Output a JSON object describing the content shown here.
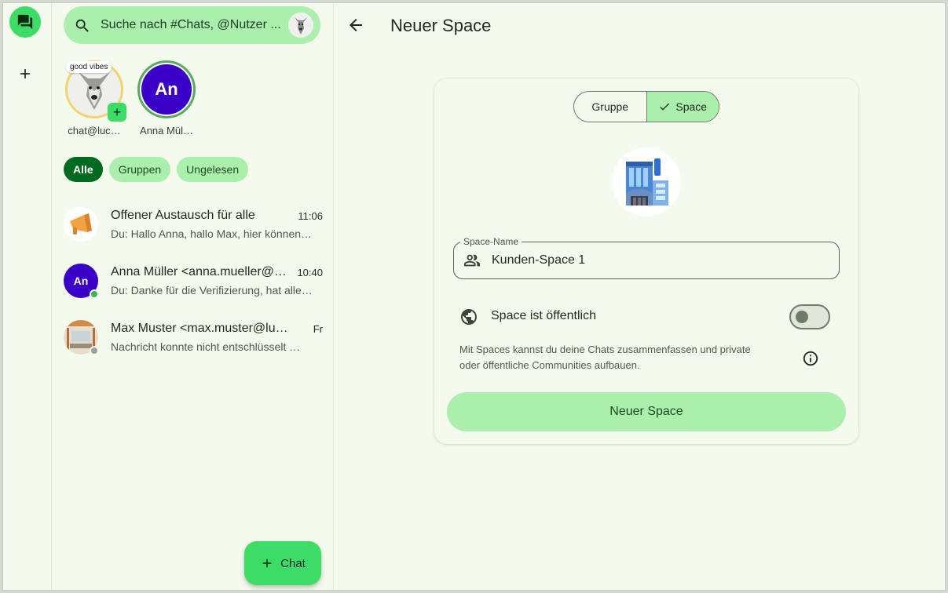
{
  "colors": {
    "accent": "#3ddc67",
    "chip": "#abefad",
    "chip_active": "#006b20",
    "background": "#f4fbee"
  },
  "rail": {
    "chat_icon": "chat-bubbles-icon",
    "add_icon": "plus-icon"
  },
  "search": {
    "placeholder": "Suche nach #Chats, @Nutzer ..."
  },
  "stories": [
    {
      "label": "chat@luc…",
      "badge": "good vibes"
    },
    {
      "label": "Anna Mül…",
      "initials": "An"
    }
  ],
  "filters": [
    {
      "label": "Alle",
      "active": true
    },
    {
      "label": "Gruppen",
      "active": false
    },
    {
      "label": "Ungelesen",
      "active": false
    }
  ],
  "chats": [
    {
      "title": "Offener Austausch für alle",
      "time": "11:06",
      "preview": "Du: Hallo Anna, hallo Max, hier können…"
    },
    {
      "title": "Anna Müller <anna.mueller@…",
      "time": "10:40",
      "preview": "Du: Danke für die Verifizierung, hat alle…",
      "initials": "An",
      "status": "online"
    },
    {
      "title": "Max Muster <max.muster@luck…",
      "time": "Fr",
      "preview": "Nachricht konnte nicht entschlüsselt …",
      "status": "offline"
    }
  ],
  "fab": {
    "label": "Chat"
  },
  "main": {
    "title": "Neuer Space",
    "segment": {
      "left": "Gruppe",
      "right": "Space",
      "selected": "Space"
    },
    "field": {
      "label": "Space-Name",
      "value": "Kunden-Space 1"
    },
    "public_label": "Space ist öffentlich",
    "public_enabled": false,
    "info": "Mit Spaces kannst du deine Chats zusammenfassen und private oder öffentliche Communities aufbauen.",
    "submit": "Neuer Space"
  }
}
